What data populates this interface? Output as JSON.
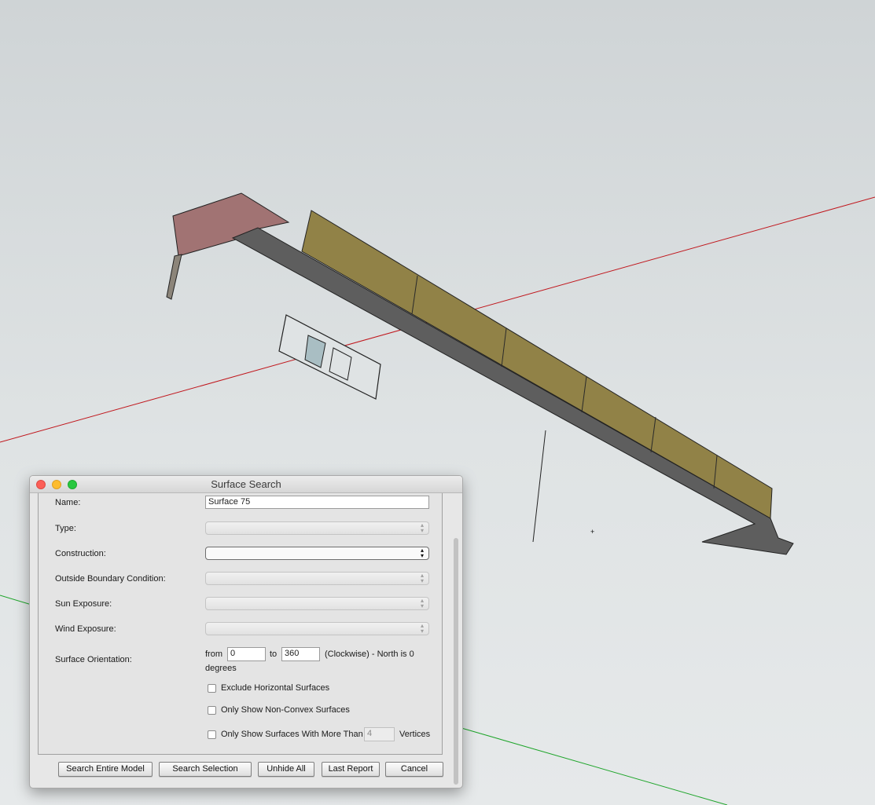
{
  "dialog": {
    "title": "Surface Search",
    "fields": {
      "name_label": "Name:",
      "name_value": "Surface 75",
      "type_label": "Type:",
      "construction_label": "Construction:",
      "outside_boundary_label": "Outside Boundary Condition:",
      "sun_exposure_label": "Sun Exposure:",
      "wind_exposure_label": "Wind Exposure:",
      "orientation_label": "Surface Orientation:",
      "orientation_from_label": "from",
      "orientation_from_value": "0",
      "orientation_to_label": "to",
      "orientation_to_value": "360",
      "orientation_note": "(Clockwise) - North is 0",
      "orientation_note_2": "degrees"
    },
    "checkboxes": {
      "exclude_horizontal": "Exclude Horizontal Surfaces",
      "non_convex": "Only Show Non-Convex Surfaces",
      "more_than": "Only Show Surfaces With More Than",
      "vertices_value": "4",
      "vertices_label": "Vertices"
    },
    "buttons": {
      "search_entire": "Search Entire Model",
      "search_selection": "Search Selection",
      "unhide_all": "Unhide All",
      "last_report": "Last Report",
      "cancel": "Cancel"
    }
  },
  "scene": {
    "colors": {
      "sky_top": "#cfd4d6",
      "red_axis": "#c0161c",
      "green_axis": "#1fa52b",
      "wall": "#918247",
      "slab": "#5e5e5e",
      "roof": "#a17373",
      "glass": "#a9bec3"
    }
  }
}
